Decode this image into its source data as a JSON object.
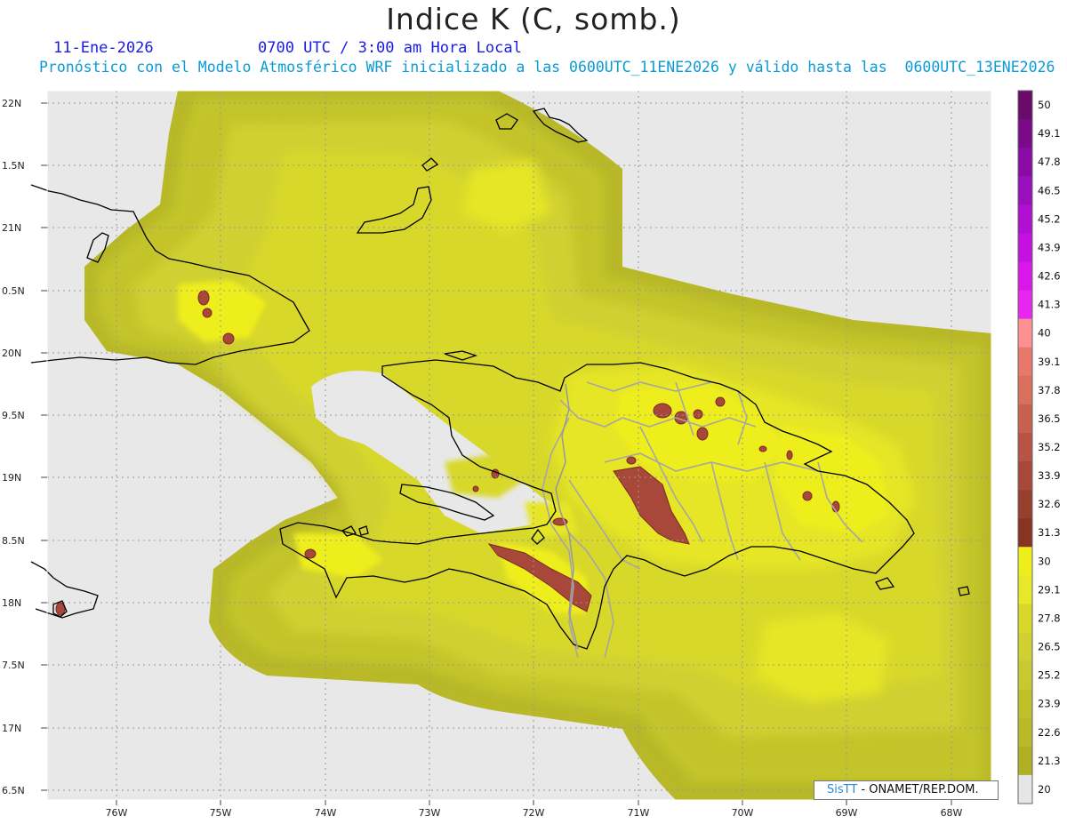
{
  "header": {
    "title": "Indice K (C, somb.)",
    "date": "11-Ene-2026",
    "time": "0700 UTC / 3:00 am Hora Local",
    "forecast_line": "Pronóstico con el Modelo Atmosférico WRF inicializado a las 0600UTC_11ENE2026 y válido hasta las  0600UTC_13ENE2026"
  },
  "axes": {
    "lon_labels": [
      "76W",
      "75W",
      "74W",
      "73W",
      "72W",
      "71W",
      "70W",
      "69W",
      "68W"
    ],
    "lat_labels": [
      "22N",
      "1.5N",
      "21N",
      "0.5N",
      "20N",
      "9.5N",
      "19N",
      "8.5N",
      "18N",
      "7.5N",
      "17N",
      "6.5N"
    ]
  },
  "colorbar": {
    "labels": [
      "50",
      "49.1",
      "47.8",
      "46.5",
      "45.2",
      "43.9",
      "42.6",
      "41.3",
      "40",
      "39.1",
      "37.8",
      "36.5",
      "35.2",
      "33.9",
      "32.6",
      "31.3",
      "30",
      "29.1",
      "27.8",
      "26.5",
      "25.2",
      "23.9",
      "22.6",
      "21.3",
      "20"
    ],
    "colors": [
      "#6a0a6a",
      "#7a0a88",
      "#8a0aa6",
      "#9a10bc",
      "#b010d2",
      "#c410e0",
      "#d818e8",
      "#e826f0",
      "#ff9090",
      "#e8786c",
      "#d8705c",
      "#c86050",
      "#b85446",
      "#a8483a",
      "#98402e",
      "#883422",
      "#eeee1c",
      "#e8e828",
      "#d8d82c",
      "#d0d030",
      "#c8c830",
      "#c0c02a",
      "#b8b828",
      "#b0b024",
      "#e6e6e6"
    ]
  },
  "credit": {
    "sis": "SisTT",
    "org": " - ONAMET/REP.DOM."
  }
}
